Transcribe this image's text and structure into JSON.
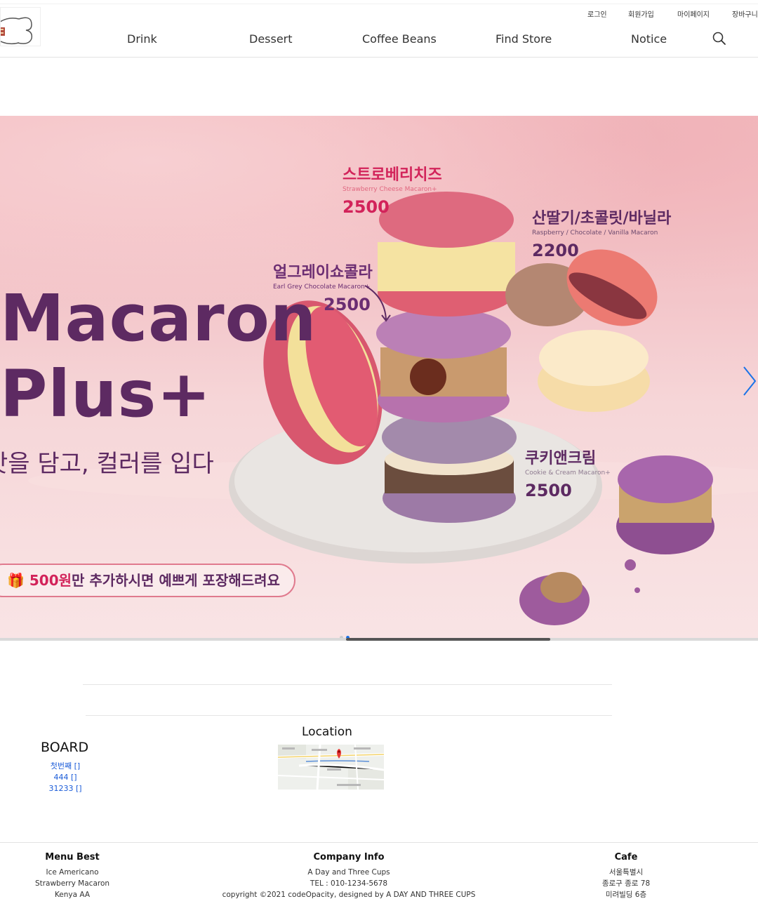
{
  "header": {
    "util_links": [
      "로그인",
      "회원가입",
      "마이페이지",
      "장바구니"
    ],
    "nav": [
      "Drink",
      "Dessert",
      "Coffee Beans",
      "Find Store",
      "Notice"
    ]
  },
  "hero": {
    "title": "Macaron\nPlus+",
    "subtitle": "맛을 담고, 컬러를 입다",
    "pill_highlight": "500원",
    "pill_text": "만 추가하시면 예쁘게 포장해드려요",
    "products": [
      {
        "ko": "스트로베리치즈",
        "en": "Strawberry Cheese Macaron+",
        "price": "2500"
      },
      {
        "ko": "산딸기/초콜릿/바닐라",
        "en": "Raspberry / Chocolate / Vanilla Macaron",
        "price": "2200"
      },
      {
        "ko": "얼그레이쇼콜라",
        "en": "Earl Grey Chocolate Macaron+",
        "price": "2500"
      },
      {
        "ko": "쿠키앤크림",
        "en": "Cookie & Cream Macaron+",
        "price": "2500"
      }
    ],
    "slides": 2,
    "active_slide": 2,
    "colors": {
      "title": "#5d2a62",
      "accent": "#d2235a",
      "background": "#f4bcc0"
    }
  },
  "board": {
    "title": "BOARD",
    "items": [
      "첫번째 []",
      "444 []",
      "31233 []"
    ]
  },
  "location": {
    "title": "Location"
  },
  "footer": {
    "menu_best": {
      "title": "Menu Best",
      "items": [
        "Ice Americano",
        "Strawberry Macaron",
        "Kenya AA"
      ]
    },
    "company": {
      "title": "Company Info",
      "items": [
        "A Day and Three Cups",
        "TEL : 010-1234-5678",
        "copyright ©2021 codeOpacity, designed by A DAY AND THREE CUPS"
      ]
    },
    "cafe": {
      "title": "Cafe",
      "items": [
        "서울특별시",
        "종로구 종로 78",
        "미려빌딩 6층"
      ]
    }
  }
}
